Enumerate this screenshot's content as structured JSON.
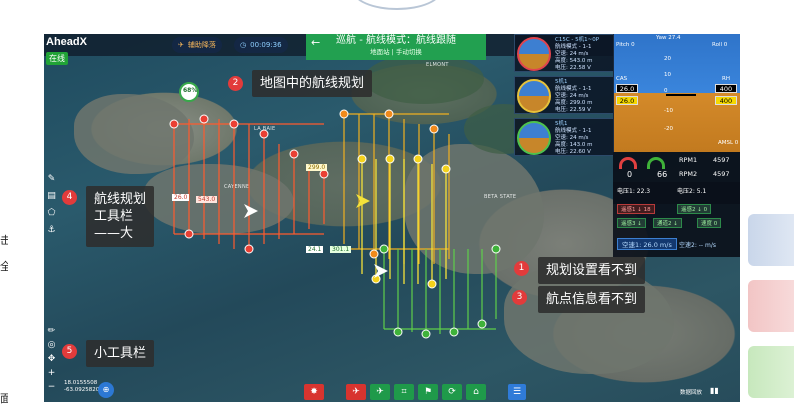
{
  "app": {
    "brand": "AheadX",
    "online_badge": "在线",
    "assist_label": "辅助降落",
    "timer": "00:09:36",
    "mode_title": "巡航 - 航线模式：航线跟随",
    "mode_sub": "地面站 | 手动切换"
  },
  "drones": [
    {
      "header": "C15C - 5机1~0P",
      "line1": "航线模式 - 1-1",
      "line2": "空速: 24 m/s",
      "line3": "高度: 543.0 m",
      "line4": "电压: 22.58 V",
      "line5": "5.08 V"
    },
    {
      "header": "5机1",
      "line1": "航线模式 - 1-1",
      "line2": "空速: 24 m/s",
      "line3": "高度: 299.0 m",
      "line4": "电压: 22.59 V",
      "line5": "5.08 V"
    },
    {
      "header": "5机1",
      "line1": "航线模式 - 1-1",
      "line2": "空速: 24 m/s",
      "line3": "高度: 143.0 m",
      "line4": "电压: 22.60 V",
      "line5": "5.08 V"
    }
  ],
  "pfd": {
    "yaw": "Yaw  27.4",
    "pitch": "Pitch 0",
    "roll": "Roll 0",
    "cas_label": "CAS",
    "cas_value": "26.0",
    "cas_value2": "26.0",
    "rh_label": "RH",
    "rh_value": "400",
    "rh_value2": "400",
    "ladder": [
      "20",
      "10",
      "0",
      "-10",
      "-20"
    ],
    "amsl": "AMSL 0"
  },
  "gauges": {
    "val_left": "0",
    "val_right": "66",
    "rpm1_label": "RPM1",
    "rpm1_value": "4597",
    "rpm2_label": "RPM2",
    "rpm2_value": "4597"
  },
  "values": {
    "voltage1": "电压1: 22.3",
    "voltage2": "电压2: 5.1",
    "chip1": "遥感1 ↓ 18",
    "chip2": "遥感2 ↓ 0",
    "chip3": "遥感3 ↓",
    "chip4": "通道1 ↓",
    "chip5": "通道2 ↓",
    "chip6": "速度 0",
    "speed1": "空速1: 26.0 m/s",
    "speed2": "空速2: -- m/s"
  },
  "route_labels": {
    "alt1": "26.0",
    "alt2": "543.0",
    "alt3": "299.0",
    "alt4": "24.1",
    "alt5": "301.1",
    "progress": "68%"
  },
  "places": [
    "LA BAIE",
    "CAYENNE",
    "BETA STATE",
    "ELMONT"
  ],
  "callouts": [
    {
      "num": "2",
      "text": "地图中的航线规划"
    },
    {
      "num": "4",
      "text": "航线规划\n工具栏\n——大"
    },
    {
      "num": "1",
      "text": "规划设置看不到"
    },
    {
      "num": "3",
      "text": "航点信息看不到"
    },
    {
      "num": "5",
      "text": "小工具栏"
    }
  ],
  "coords": {
    "lat": "18.0155508",
    "lon": "-63.0925820"
  },
  "bottom_right": "数据回放",
  "left_fragments": [
    "击",
    "全",
    "面"
  ]
}
